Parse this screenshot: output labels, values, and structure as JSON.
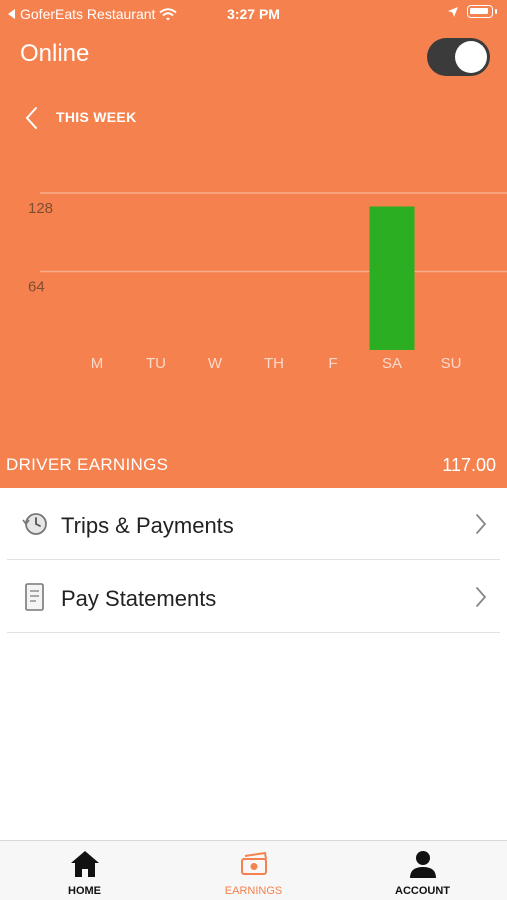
{
  "status_bar": {
    "back_app": "GoferEats Restaurant",
    "time": "3:27 PM"
  },
  "header": {
    "online_label": "Online",
    "toggle_on": true,
    "period_label": "THIS WEEK"
  },
  "chart_data": {
    "type": "bar",
    "categories": [
      "M",
      "TU",
      "W",
      "TH",
      "F",
      "SA",
      "SU"
    ],
    "values": [
      0,
      0,
      0,
      0,
      0,
      117,
      0
    ],
    "ytick_labels": [
      "128",
      "64"
    ],
    "ytick_values": [
      128,
      64
    ],
    "ylim": [
      0,
      128
    ],
    "bar_color": "#2CAE22",
    "grid": true
  },
  "summary": {
    "label": "DRIVER EARNINGS",
    "value": "117.00"
  },
  "menu": {
    "items": [
      {
        "label": "Trips & Payments",
        "icon": "history-icon"
      },
      {
        "label": "Pay Statements",
        "icon": "receipt-icon"
      }
    ]
  },
  "tabbar": {
    "tabs": [
      {
        "label": "HOME",
        "icon": "home-icon"
      },
      {
        "label": "EARNINGS",
        "icon": "money-icon",
        "active": true
      },
      {
        "label": "ACCOUNT",
        "icon": "account-icon"
      }
    ]
  },
  "colors": {
    "brand": "#F5814E",
    "bar": "#2CAE22"
  }
}
